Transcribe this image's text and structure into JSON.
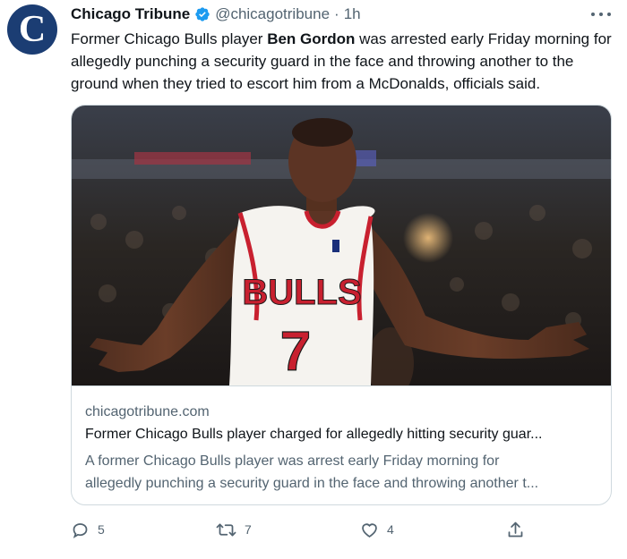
{
  "account": {
    "name": "Chicago Tribune",
    "handle": "@chicagotribune",
    "separator": "·",
    "time": "1h",
    "avatar_letter": "C",
    "avatar_color": "#1b3d73"
  },
  "tweet": {
    "text_before": "Former Chicago Bulls player ",
    "text_bold": "Ben Gordon",
    "text_after": " was arrested early Friday morning for allegedly punching a security guard in the face and throwing another to the ground when they tried to escort him from a McDonalds, officials said."
  },
  "card": {
    "jersey_word": "BULLS",
    "jersey_number": "7",
    "domain": "chicagotribune.com",
    "title": "Former Chicago Bulls player charged for allegedly hitting security guar...",
    "description_line1": "A former Chicago Bulls player was arrest early Friday morning for",
    "description_line2": "allegedly punching a security guard in the face and throwing another t..."
  },
  "actions": {
    "replies": "5",
    "retweets": "7",
    "likes": "4"
  },
  "colors": {
    "text": "#0f1419",
    "secondary": "#536471",
    "verified": "#1d9bf0",
    "border": "#cfd9de"
  }
}
